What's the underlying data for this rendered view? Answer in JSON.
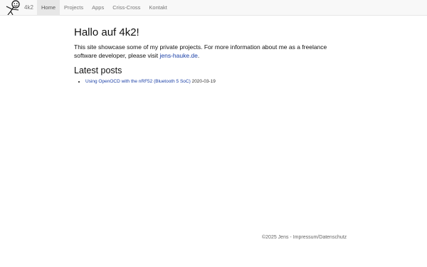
{
  "nav": {
    "brand": "4k2",
    "items": [
      {
        "label": "Home",
        "active": true
      },
      {
        "label": "Projects",
        "active": false
      },
      {
        "label": "Apps",
        "active": false
      },
      {
        "label": "Criss-Cross",
        "active": false
      },
      {
        "label": "Kontakt",
        "active": false
      }
    ]
  },
  "main": {
    "heading": "Hallo auf 4k2!",
    "intro_text": "This site showcase some of my private projects. For more information about me as a freelance software developer, please visit ",
    "intro_link": "jens-hauke.de",
    "intro_end": ".",
    "posts_heading": "Latest posts",
    "posts": [
      {
        "title": "Using OpenOCD with the nRF52 (Bluetooth 5 SoC)",
        "date": "2020-03-19"
      }
    ]
  },
  "footer": {
    "copyright": "©2025 Jens",
    "separator": " - ",
    "link": "Impressum/Datenschutz"
  },
  "colors": {
    "link": "#1a3fa6",
    "navbar_bg": "#f8f8f8",
    "active_tab_bg": "#e7e7e7"
  }
}
